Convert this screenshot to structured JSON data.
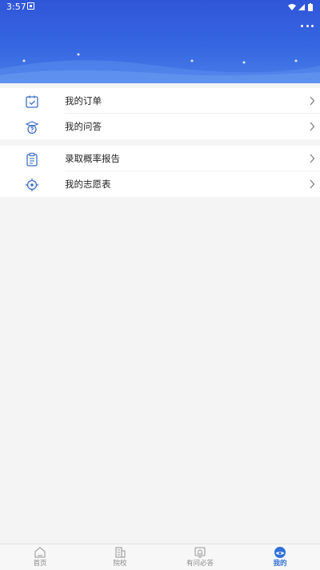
{
  "status_bar": {
    "time": "3:57"
  },
  "menu_groups": [
    {
      "items": [
        {
          "label": "我的订单",
          "icon": "calendar-check-icon"
        },
        {
          "label": "我的问答",
          "icon": "question-bubble-icon"
        }
      ]
    },
    {
      "items": [
        {
          "label": "录取概率报告",
          "icon": "clipboard-icon"
        },
        {
          "label": "我的志愿表",
          "icon": "target-icon"
        }
      ]
    }
  ],
  "tabs": [
    {
      "label": "首页",
      "icon": "home-icon",
      "active": false
    },
    {
      "label": "院校",
      "icon": "building-icon",
      "active": false
    },
    {
      "label": "有问必答",
      "icon": "qa-bell-icon",
      "active": false
    },
    {
      "label": "我的",
      "icon": "profile-icon",
      "active": true
    }
  ],
  "colors": {
    "accent": "#2f6fd8",
    "header": "#3563df"
  }
}
